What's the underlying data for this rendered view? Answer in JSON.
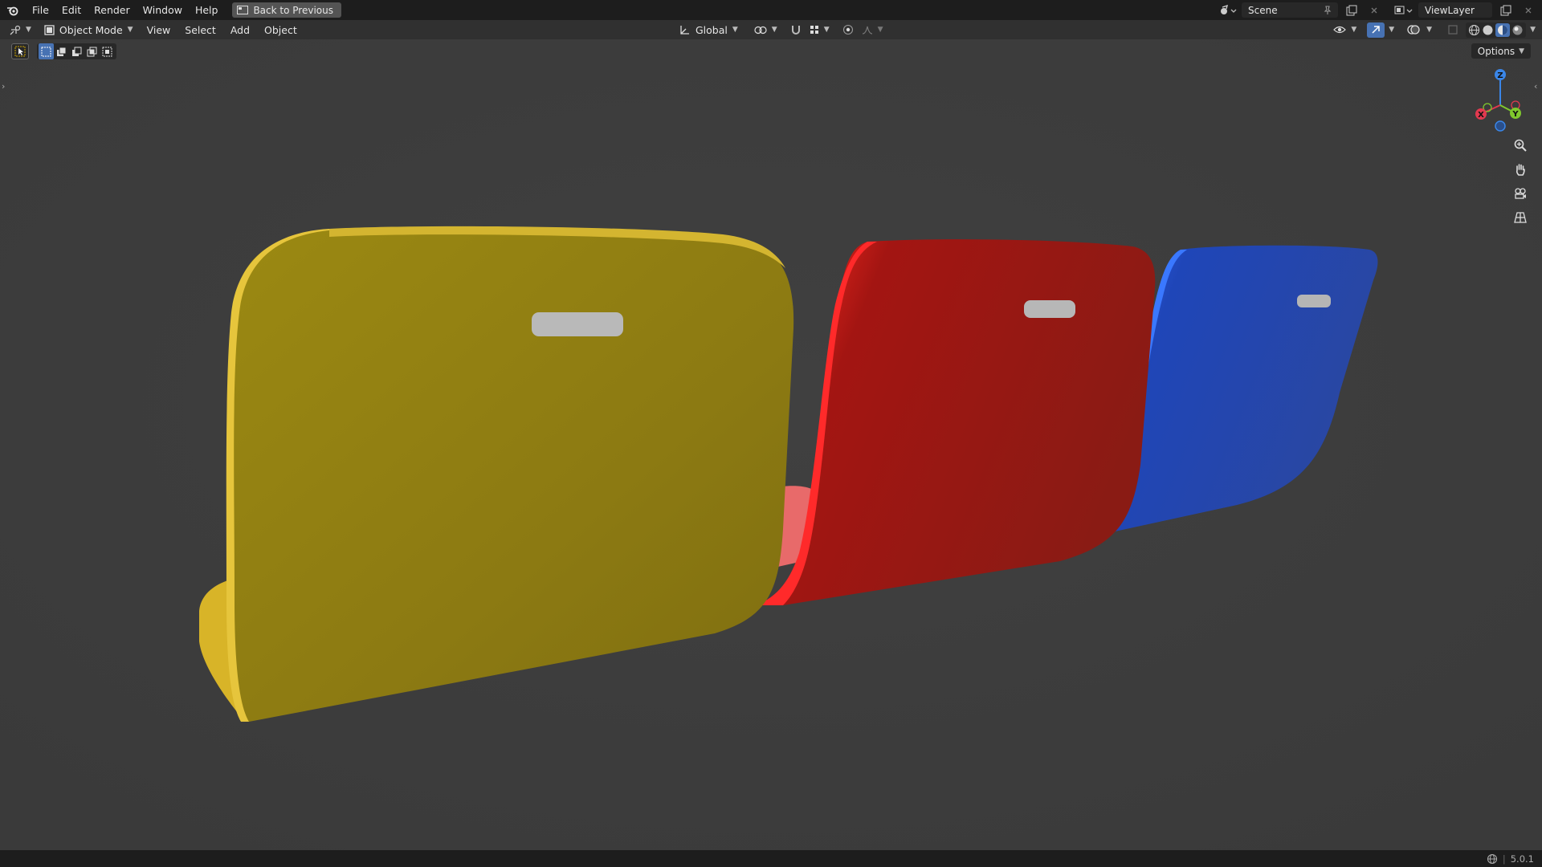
{
  "topbar": {
    "menus": [
      "File",
      "Edit",
      "Render",
      "Window",
      "Help"
    ],
    "back_button": "Back to Previous",
    "scene_name": "Scene",
    "view_layer_name": "ViewLayer"
  },
  "header": {
    "editor_type_icon": "viewport-icon",
    "mode": "Object Mode",
    "menus": [
      "View",
      "Select",
      "Add",
      "Object"
    ],
    "transform_orientation": "Global"
  },
  "toolbar": {
    "options_label": "Options"
  },
  "gizmo": {
    "axes": [
      "X",
      "Y",
      "Z"
    ],
    "colors": {
      "x": "#e2394f",
      "y": "#7fc82d",
      "z": "#3a86e8"
    }
  },
  "objects": {
    "seat_colors": {
      "yellow": "#b79f12",
      "red": "#c21a16",
      "blue": "#2553d4",
      "handle": "#b7b7b7"
    }
  },
  "status": {
    "version": "5.0.1"
  }
}
